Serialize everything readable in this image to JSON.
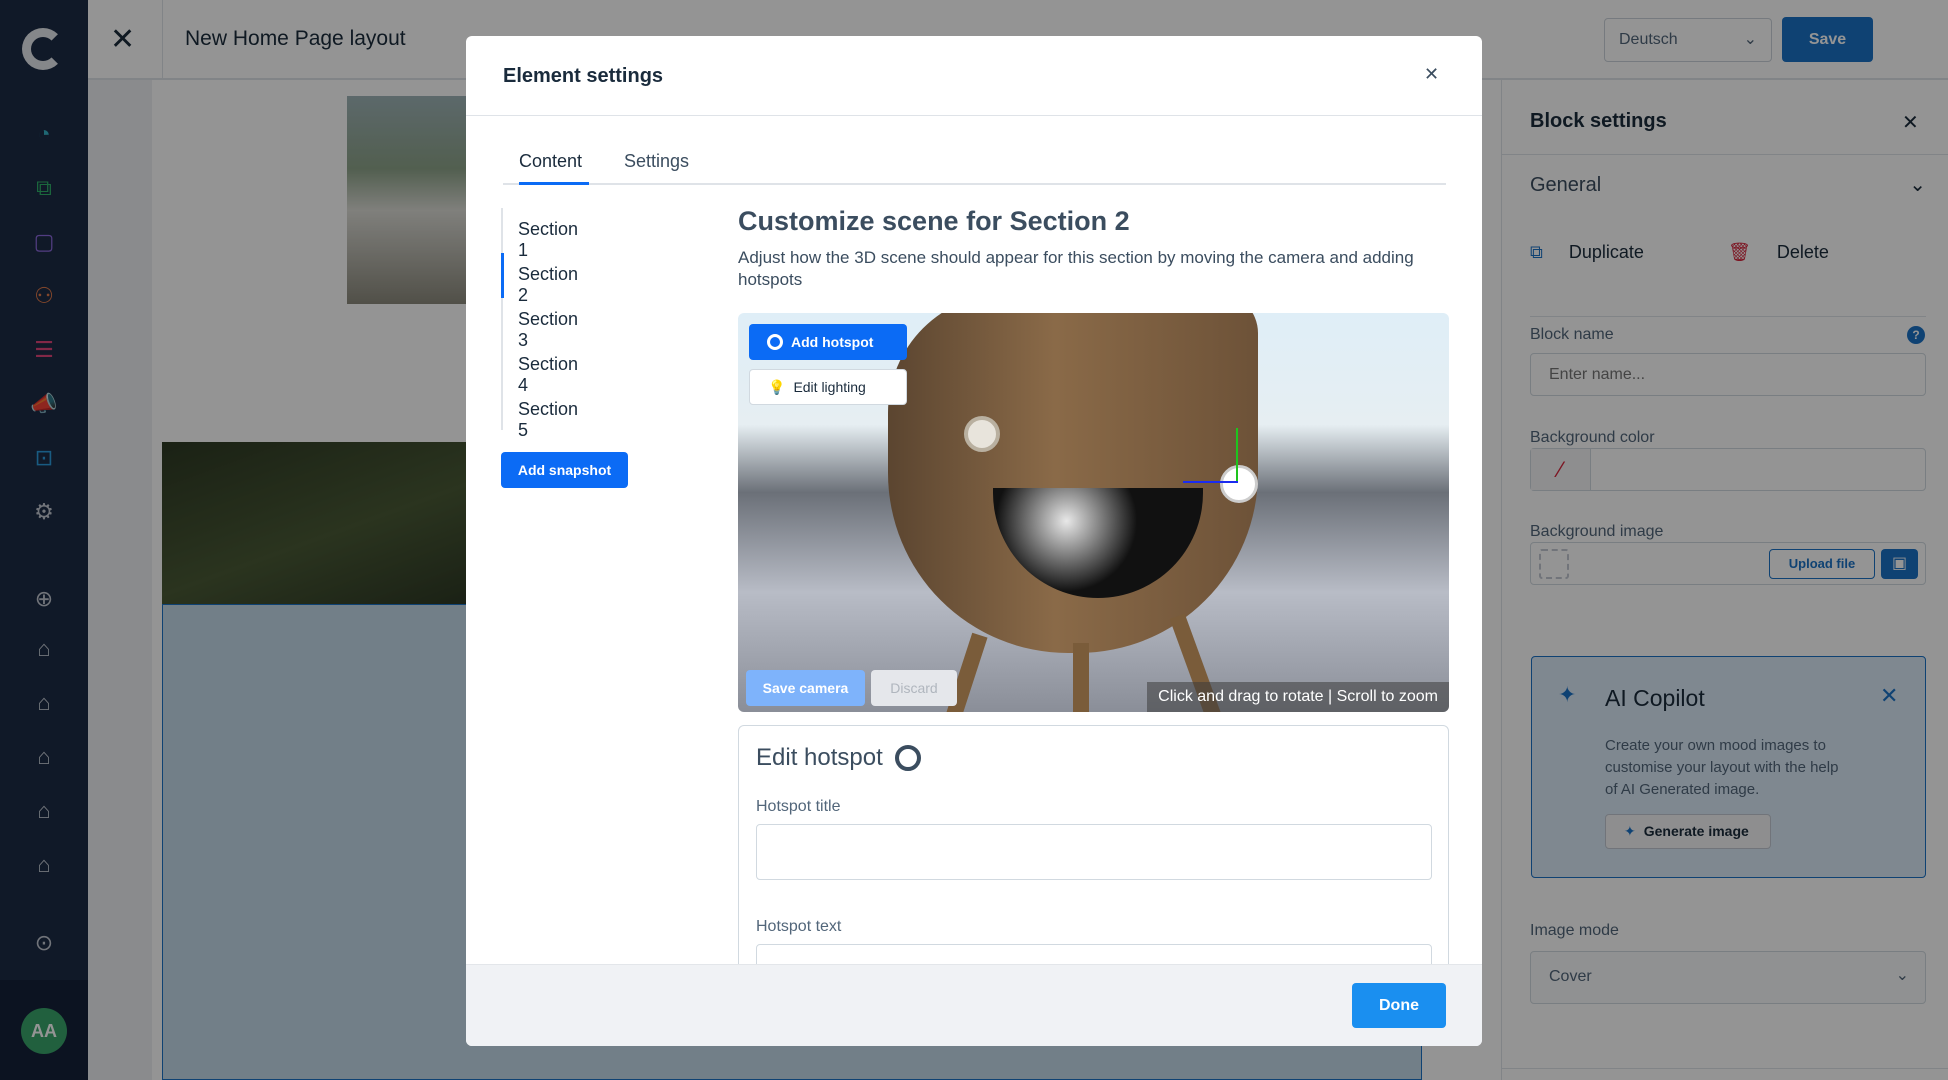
{
  "sidebar": {
    "icons": [
      "dashboard-icon",
      "catalog-icon",
      "orders-icon",
      "customers-icon",
      "content-icon",
      "marketing-icon",
      "extensions-icon",
      "settings-icon",
      "add-channel-icon",
      "storefront-icon",
      "storefront-icon",
      "storefront-icon",
      "storefront-icon",
      "storefront-icon",
      "expand-icon"
    ],
    "avatar": "AA",
    "colors": {
      "bg": "#1c2b45",
      "avatar": "#3aa56b"
    }
  },
  "topbar": {
    "title": "New Home Page layout",
    "language": "Deutsch",
    "save_label": "Save"
  },
  "block_settings": {
    "title": "Block settings",
    "section": "General",
    "duplicate": "Duplicate",
    "delete": "Delete",
    "block_name_label": "Block name",
    "block_name_placeholder": "Enter name...",
    "bg_color_label": "Background color",
    "bg_image_label": "Background image",
    "upload_label": "Upload file",
    "copilot": {
      "title": "AI Copilot",
      "text": "Create your own mood images to customise your layout with the help of AI Generated image.",
      "button": "Generate image"
    },
    "image_mode_label": "Image mode",
    "image_mode_value": "Cover"
  },
  "modal": {
    "title": "Element settings",
    "tabs": [
      "Content",
      "Settings"
    ],
    "active_tab": "Content",
    "sections": [
      "Section 1",
      "Section 2",
      "Section 3",
      "Section 4",
      "Section 5"
    ],
    "active_section": "Section 2",
    "add_snapshot": "Add snapshot",
    "heading": "Customize scene for Section 2",
    "description": "Adjust how the 3D scene should appear for this section by moving the camera and adding hotspots",
    "viewer": {
      "add_hotspot": "Add hotspot",
      "edit_lighting": "Edit lighting",
      "save_camera": "Save camera",
      "discard": "Discard",
      "hint": "Click and drag to rotate | Scroll to zoom"
    },
    "edit_hotspot": {
      "title": "Edit hotspot",
      "hotspot_title_label": "Hotspot title",
      "hotspot_text_label": "Hotspot text"
    },
    "done": "Done",
    "accent": "#0b6bf5"
  }
}
